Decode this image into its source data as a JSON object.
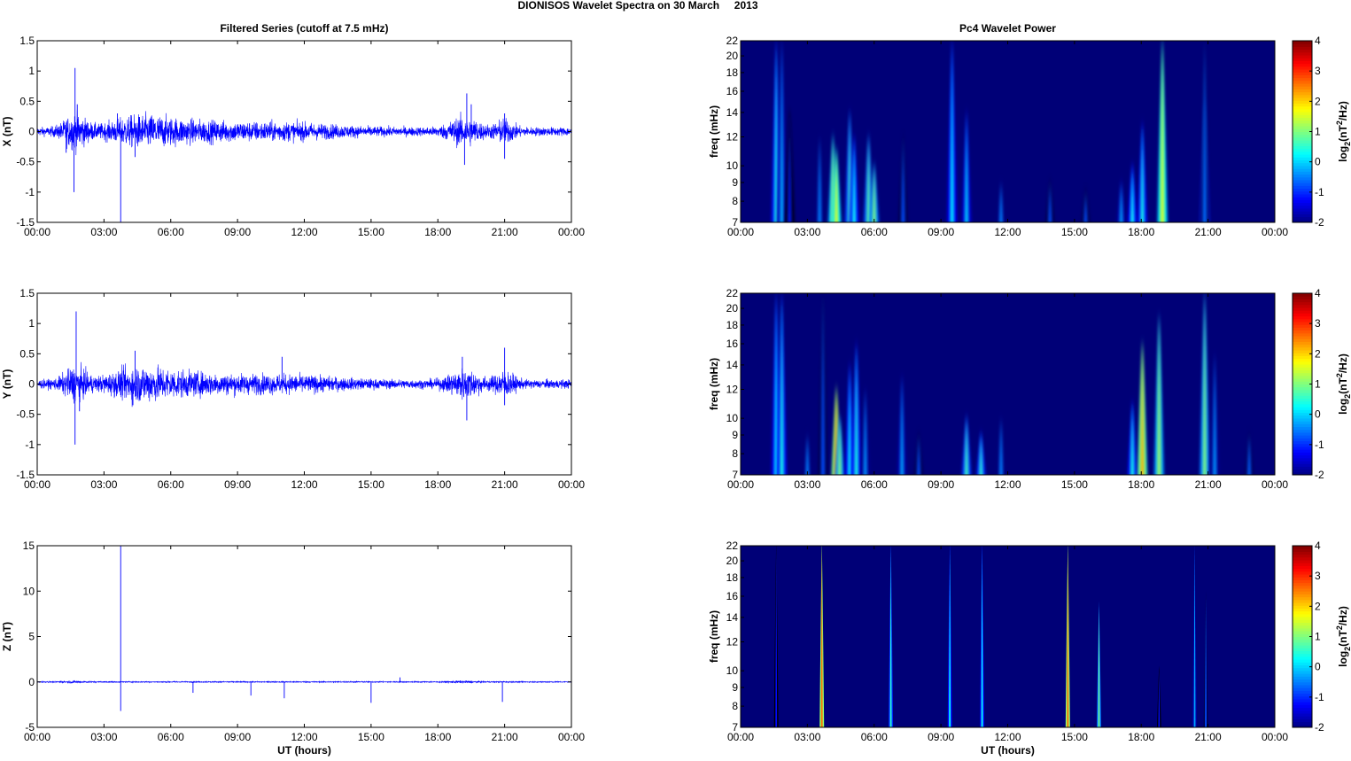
{
  "title": "DIONISOS Wavelet Spectra on 30 March     2013",
  "chart_data": [
    {
      "type": "line",
      "title": "Filtered Series (cutoff at 7.5 mHz)",
      "ylabel": "X (nT)",
      "xlabel": "",
      "xlim": [
        0,
        24
      ],
      "ylim": [
        -1.5,
        1.5
      ],
      "yticks": [
        "-1.5",
        "-1",
        "-0.5",
        "0",
        "0.5",
        "1",
        "1.5"
      ],
      "ytick_values": [
        -1.5,
        -1,
        -0.5,
        0,
        0.5,
        1,
        1.5
      ],
      "xticks": [
        "00:00",
        "03:00",
        "06:00",
        "09:00",
        "12:00",
        "15:00",
        "18:00",
        "21:00",
        "00:00"
      ],
      "color": "#0000ff",
      "noise_base": 0.05,
      "bursts": [
        [
          1.7,
          0.6,
          0.16
        ],
        [
          4.5,
          1.5,
          0.1
        ],
        [
          6.5,
          2.5,
          0.08
        ],
        [
          11,
          3,
          0.06
        ],
        [
          19.2,
          0.8,
          0.13
        ],
        [
          21,
          0.5,
          0.1
        ]
      ],
      "spikes": [
        [
          1.7,
          1.05
        ],
        [
          1.65,
          -1.0
        ],
        [
          1.8,
          0.45
        ],
        [
          3.75,
          -1.5
        ],
        [
          3.6,
          0.3
        ],
        [
          1.3,
          -0.35
        ],
        [
          4.4,
          -0.42
        ],
        [
          19.3,
          0.63
        ],
        [
          19.2,
          -0.55
        ],
        [
          19.5,
          0.45
        ],
        [
          21.0,
          0.3
        ],
        [
          21.0,
          -0.45
        ]
      ]
    },
    {
      "type": "line",
      "ylabel": "Y (nT)",
      "xlabel": "",
      "xlim": [
        0,
        24
      ],
      "ylim": [
        -1.5,
        1.5
      ],
      "yticks": [
        "-1.5",
        "-1",
        "-0.5",
        "0",
        "0.5",
        "1",
        "1.5"
      ],
      "ytick_values": [
        -1.5,
        -1,
        -0.5,
        0,
        0.5,
        1,
        1.5
      ],
      "xticks": [
        "00:00",
        "03:00",
        "06:00",
        "09:00",
        "12:00",
        "15:00",
        "18:00",
        "21:00",
        "00:00"
      ],
      "color": "#0000ff",
      "noise_base": 0.05,
      "bursts": [
        [
          1.7,
          0.6,
          0.15
        ],
        [
          4.5,
          1.5,
          0.12
        ],
        [
          6.5,
          2.5,
          0.08
        ],
        [
          11,
          3,
          0.06
        ],
        [
          19.2,
          0.8,
          0.13
        ],
        [
          21,
          0.5,
          0.11
        ]
      ],
      "spikes": [
        [
          1.75,
          1.2
        ],
        [
          1.7,
          -1.0
        ],
        [
          1.9,
          -0.45
        ],
        [
          4.4,
          0.55
        ],
        [
          4.3,
          -0.35
        ],
        [
          11.0,
          0.45
        ],
        [
          19.1,
          0.45
        ],
        [
          19.3,
          -0.6
        ],
        [
          21.0,
          0.6
        ],
        [
          21.0,
          -0.35
        ]
      ]
    },
    {
      "type": "line",
      "ylabel": "Z (nT)",
      "xlabel": "UT (hours)",
      "xlim": [
        0,
        24
      ],
      "ylim": [
        -5,
        15
      ],
      "yticks": [
        "-5",
        "0",
        "5",
        "10",
        "15"
      ],
      "ytick_values": [
        -5,
        0,
        5,
        10,
        15
      ],
      "xticks": [
        "00:00",
        "03:00",
        "06:00",
        "09:00",
        "12:00",
        "15:00",
        "18:00",
        "21:00",
        "00:00"
      ],
      "color": "#0000ff",
      "noise_base": 0.07,
      "bursts": [
        [
          1.7,
          0.6,
          0.1
        ],
        [
          19.2,
          0.8,
          0.1
        ]
      ],
      "spikes": [
        [
          3.75,
          15
        ],
        [
          3.75,
          -3.2
        ],
        [
          7.0,
          -1.2
        ],
        [
          9.6,
          -1.5
        ],
        [
          11.1,
          -1.8
        ],
        [
          15.0,
          -2.3
        ],
        [
          16.3,
          0.5
        ],
        [
          20.9,
          -2.2
        ]
      ]
    },
    {
      "type": "heatmap",
      "title": "Pc4 Wavelet Power",
      "ylabel": "freq (mHz)",
      "xlabel": "",
      "xlim": [
        0,
        24
      ],
      "ylim": [
        7,
        22
      ],
      "yscale": "log",
      "yticks": [
        "7",
        "8",
        "9",
        "10",
        "12",
        "14",
        "16",
        "18",
        "20",
        "22"
      ],
      "ytick_values": [
        7,
        8,
        9,
        10,
        12,
        14,
        16,
        18,
        20,
        22
      ],
      "xticks": [
        "00:00",
        "03:00",
        "06:00",
        "09:00",
        "12:00",
        "15:00",
        "18:00",
        "21:00",
        "00:00"
      ],
      "colorbar": {
        "label": [
          "log",
          "2",
          "(nT",
          "2",
          "/Hz)"
        ],
        "ticks": [
          "4",
          "3",
          "2",
          "1",
          "0",
          "-1",
          "-2"
        ],
        "range": [
          -2,
          4
        ]
      },
      "streaks": [
        [
          1.6,
          22,
          0.4
        ],
        [
          1.85,
          22,
          -0.2
        ],
        [
          3.55,
          12,
          -0.5
        ],
        [
          4.15,
          12,
          1.3
        ],
        [
          4.3,
          11,
          1.6
        ],
        [
          4.9,
          14,
          0.6
        ],
        [
          5.1,
          12,
          0.3
        ],
        [
          5.75,
          12,
          0.8
        ],
        [
          6.0,
          10,
          1.0
        ],
        [
          9.5,
          22,
          0.2
        ],
        [
          10.15,
          14,
          0
        ],
        [
          11.7,
          9,
          -0.5
        ],
        [
          13.9,
          9,
          -0.8
        ],
        [
          15.5,
          8.5,
          -0.8
        ],
        [
          17.1,
          9,
          -0.3
        ],
        [
          17.6,
          10,
          0.3
        ],
        [
          18.05,
          13,
          0.4
        ],
        [
          18.95,
          22,
          1.6
        ],
        [
          20.85,
          15,
          0.5
        ],
        [
          20.85,
          22,
          -0.6
        ],
        [
          7.3,
          12,
          -0.8
        ],
        [
          2.2,
          14,
          -1.1
        ]
      ]
    },
    {
      "type": "heatmap",
      "ylabel": "freq (mHz)",
      "xlabel": "",
      "xlim": [
        0,
        24
      ],
      "ylim": [
        7,
        22
      ],
      "yscale": "log",
      "yticks": [
        "7",
        "8",
        "9",
        "10",
        "12",
        "14",
        "16",
        "18",
        "20",
        "22"
      ],
      "ytick_values": [
        7,
        8,
        9,
        10,
        12,
        14,
        16,
        18,
        20,
        22
      ],
      "xticks": [
        "00:00",
        "03:00",
        "06:00",
        "09:00",
        "12:00",
        "15:00",
        "18:00",
        "21:00",
        "00:00"
      ],
      "colorbar": {
        "label": [
          "log",
          "2",
          "(nT",
          "2",
          "/Hz)"
        ],
        "ticks": [
          "4",
          "3",
          "2",
          "1",
          "0",
          "-1",
          "-2"
        ],
        "range": [
          -2,
          4
        ]
      },
      "streaks": [
        [
          1.6,
          22,
          0.2
        ],
        [
          1.85,
          22,
          0.4
        ],
        [
          3.0,
          9,
          -0.5
        ],
        [
          3.7,
          22,
          -0.8
        ],
        [
          4.3,
          12,
          2.5
        ],
        [
          4.45,
          10,
          1.0
        ],
        [
          4.9,
          14,
          0.2
        ],
        [
          5.2,
          16,
          0.4
        ],
        [
          5.6,
          12,
          -0.4
        ],
        [
          7.25,
          13,
          -0.3
        ],
        [
          8.0,
          9,
          -0.8
        ],
        [
          10.15,
          10,
          0.6
        ],
        [
          10.8,
          9,
          0.5
        ],
        [
          11.7,
          10,
          -0.5
        ],
        [
          17.6,
          11,
          0.4
        ],
        [
          18.05,
          16,
          2.2
        ],
        [
          18.8,
          19,
          1.2
        ],
        [
          20.85,
          22,
          1.0
        ],
        [
          21.3,
          15,
          -0.4
        ],
        [
          22.85,
          9,
          -0.7
        ]
      ]
    },
    {
      "type": "heatmap",
      "ylabel": "freq (mHz)",
      "xlabel": "UT (hours)",
      "xlim": [
        0,
        24
      ],
      "ylim": [
        7,
        22
      ],
      "yscale": "log",
      "yticks": [
        "7",
        "8",
        "9",
        "10",
        "12",
        "14",
        "16",
        "18",
        "20",
        "22"
      ],
      "ytick_values": [
        7,
        8,
        9,
        10,
        12,
        14,
        16,
        18,
        20,
        22
      ],
      "xticks": [
        "00:00",
        "03:00",
        "06:00",
        "09:00",
        "12:00",
        "15:00",
        "18:00",
        "21:00",
        "00:00"
      ],
      "colorbar": {
        "label": [
          "log",
          "2",
          "(nT",
          "2",
          "/Hz)"
        ],
        "ticks": [
          "4",
          "3",
          "2",
          "1",
          "0",
          "-1",
          "-2"
        ],
        "range": [
          -2,
          4
        ]
      },
      "streaks": [
        [
          3.65,
          22,
          2.6,
          1
        ],
        [
          6.75,
          22,
          0.5,
          1
        ],
        [
          9.4,
          22,
          0.3,
          1
        ],
        [
          10.85,
          22,
          0.3,
          1
        ],
        [
          14.7,
          22,
          2.6,
          1
        ],
        [
          16.1,
          15,
          0.9,
          1
        ],
        [
          20.4,
          22,
          -0.3,
          1
        ],
        [
          20.9,
          16,
          -0.8,
          1
        ],
        [
          1.6,
          22,
          -1.2,
          1
        ],
        [
          18.8,
          10,
          -1.2,
          1
        ]
      ]
    }
  ]
}
